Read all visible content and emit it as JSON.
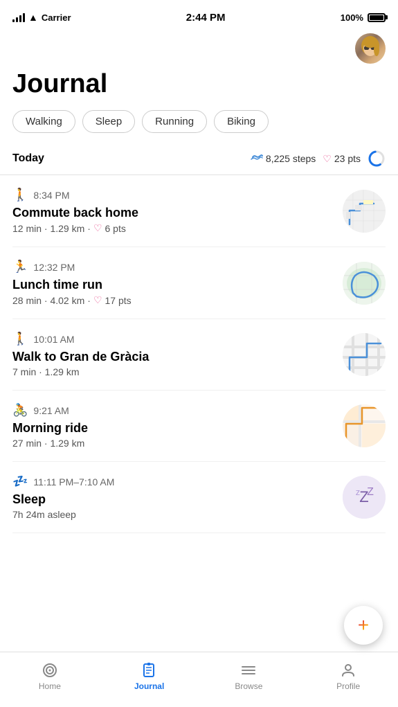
{
  "status": {
    "carrier": "Carrier",
    "time": "2:44 PM",
    "battery": "100%"
  },
  "title": "Journal",
  "filters": [
    "Walking",
    "Sleep",
    "Running",
    "Biking"
  ],
  "today": {
    "label": "Today",
    "steps": "8,225 steps",
    "points": "23 pts"
  },
  "activities": [
    {
      "id": "walk-home",
      "icon": "🚶",
      "time": "8:34 PM",
      "name": "Commute back home",
      "details": "12 min · 1.29 km",
      "points": "6 pts",
      "hasHeart": true,
      "mapType": "walk1"
    },
    {
      "id": "run-lunch",
      "icon": "🏃",
      "time": "12:32 PM",
      "name": "Lunch time run",
      "details": "28 min · 4.02 km",
      "points": "17 pts",
      "hasHeart": true,
      "mapType": "run"
    },
    {
      "id": "walk-gracia",
      "icon": "🚶",
      "time": "10:01 AM",
      "name": "Walk to Gran de Gràcia",
      "details": "7 min · 1.29 km",
      "points": null,
      "hasHeart": false,
      "mapType": "walk2"
    },
    {
      "id": "bike-morning",
      "icon": "🚴",
      "time": "9:21 AM",
      "name": "Morning ride",
      "details": "27 min · 1.29 km",
      "points": null,
      "hasHeart": false,
      "mapType": "bike"
    },
    {
      "id": "sleep",
      "icon": "💤",
      "time": "11:11 PM–7:10 AM",
      "name": "Sleep",
      "details": "7h 24m asleep",
      "points": null,
      "hasHeart": false,
      "mapType": "sleep"
    }
  ],
  "nav": {
    "items": [
      {
        "id": "home",
        "label": "Home",
        "active": false
      },
      {
        "id": "journal",
        "label": "Journal",
        "active": true
      },
      {
        "id": "browse",
        "label": "Browse",
        "active": false
      },
      {
        "id": "profile",
        "label": "Profile",
        "active": false
      }
    ]
  },
  "fab": {
    "label": "+"
  }
}
